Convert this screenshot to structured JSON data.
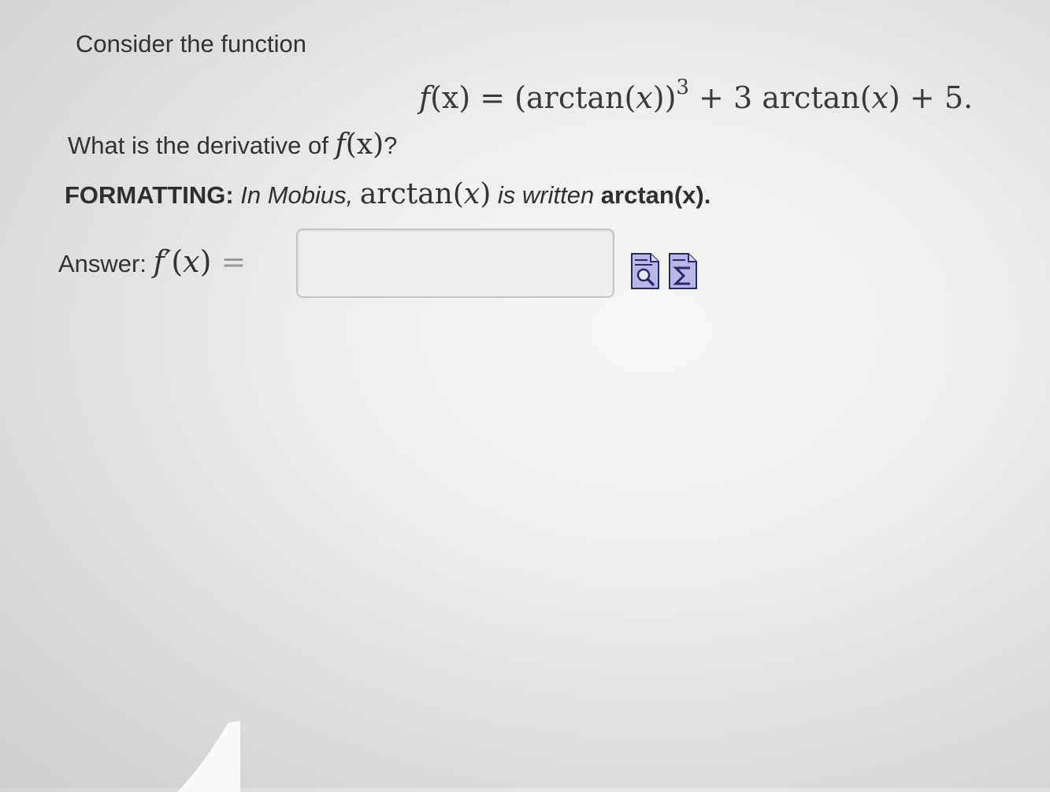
{
  "question": {
    "intro": "Consider the function",
    "formula": {
      "lhs_f": "f",
      "lhs_arg": "(x)",
      "equals": " = ",
      "term1_open": "(arctan(",
      "term1_x": "x",
      "term1_close": "))",
      "term1_exp": "3",
      "term2": " + 3 arctan(",
      "term2_x": "x",
      "term2_close": ") + 5."
    },
    "ask_prefix": "What is the derivative of ",
    "ask_f": "f",
    "ask_arg": "(x)",
    "ask_suffix": "?"
  },
  "formatting": {
    "label": "FORMATTING:",
    "text1": " In Mobius, ",
    "math_func": "arctan(",
    "math_x": "x",
    "math_close": ")",
    "text2": " is written ",
    "code": "arctan(x)."
  },
  "answer": {
    "label": "Answer: ",
    "f_prime": "f′",
    "arg_open": "(",
    "arg_x": "x",
    "arg_close": ")",
    "equals": " =",
    "value": "",
    "placeholder": ""
  },
  "icons": {
    "preview": "preview-icon",
    "equation_editor": "equation-editor-icon"
  }
}
